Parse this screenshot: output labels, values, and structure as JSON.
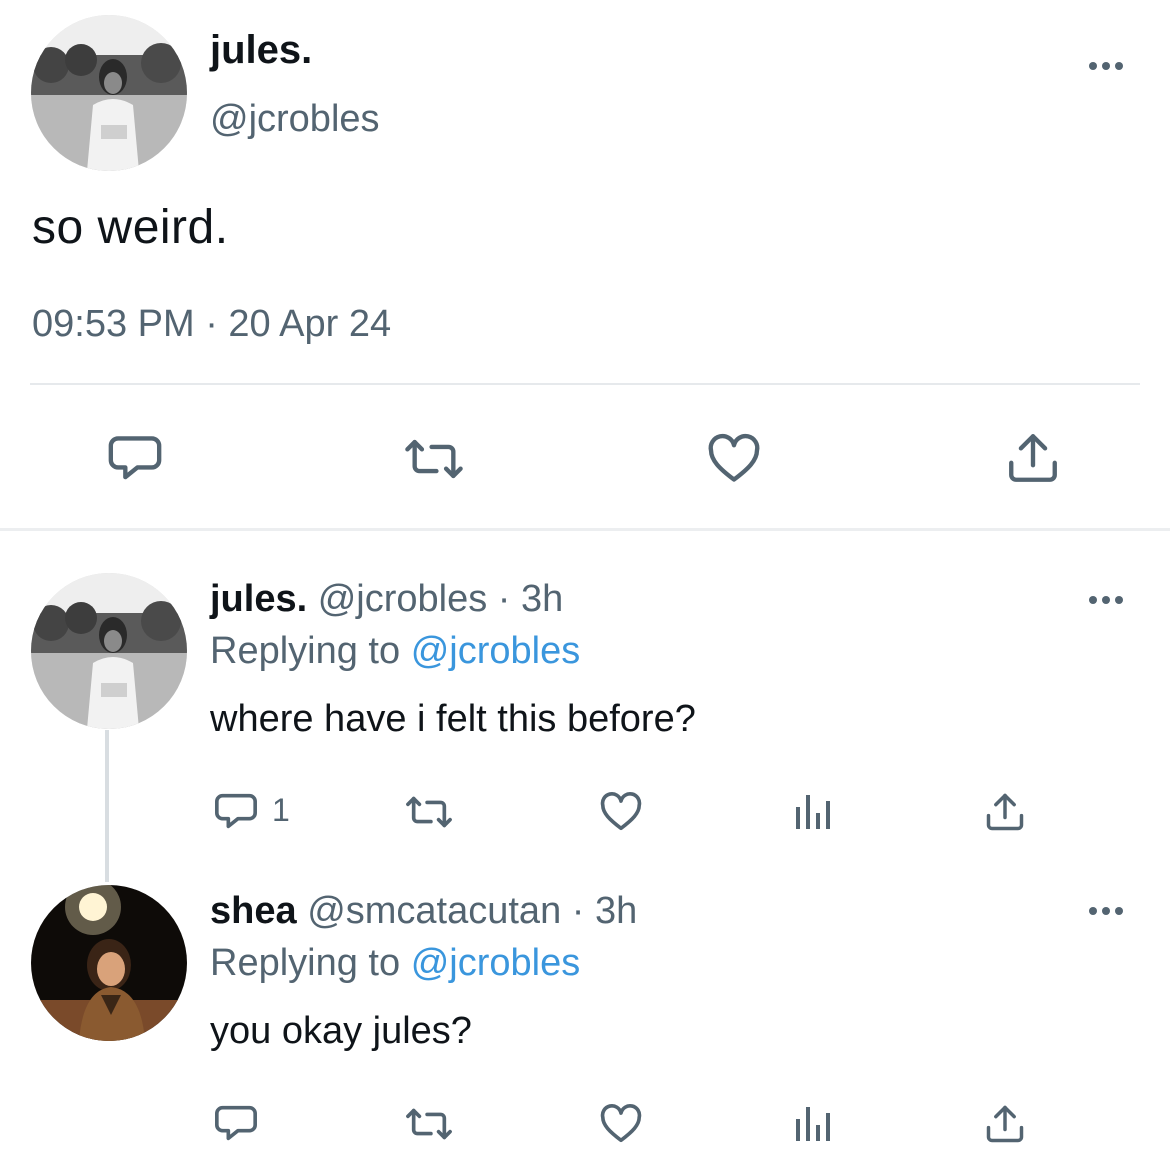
{
  "main_tweet": {
    "display_name": "jules.",
    "handle": "@jcrobles",
    "text": "so weird.",
    "timestamp": "09:53 PM · 20 Apr 24",
    "actions": [
      "reply-icon",
      "retweet-icon",
      "like-icon",
      "share-icon"
    ]
  },
  "replies": [
    {
      "display_name": "jules.",
      "meta": "@jcrobles · 3h",
      "replying_prefix": "Replying to",
      "replying_mention": "@jcrobles",
      "text": "where have i felt this before?",
      "reply_count": "1",
      "actions": [
        "reply-icon",
        "retweet-icon",
        "like-icon",
        "analytics-icon",
        "share-icon"
      ]
    },
    {
      "display_name": "shea",
      "meta": "@smcatacutan · 3h",
      "replying_prefix": "Replying to",
      "replying_mention": "@jcrobles",
      "text": "you okay jules?",
      "reply_count": "",
      "actions": [
        "reply-icon",
        "retweet-icon",
        "like-icon",
        "analytics-icon",
        "share-icon"
      ]
    }
  ],
  "colors": {
    "text_primary": "#0f1419",
    "text_secondary": "#536471",
    "mention": "#3a96dd",
    "divider": "#e6e9ec"
  }
}
